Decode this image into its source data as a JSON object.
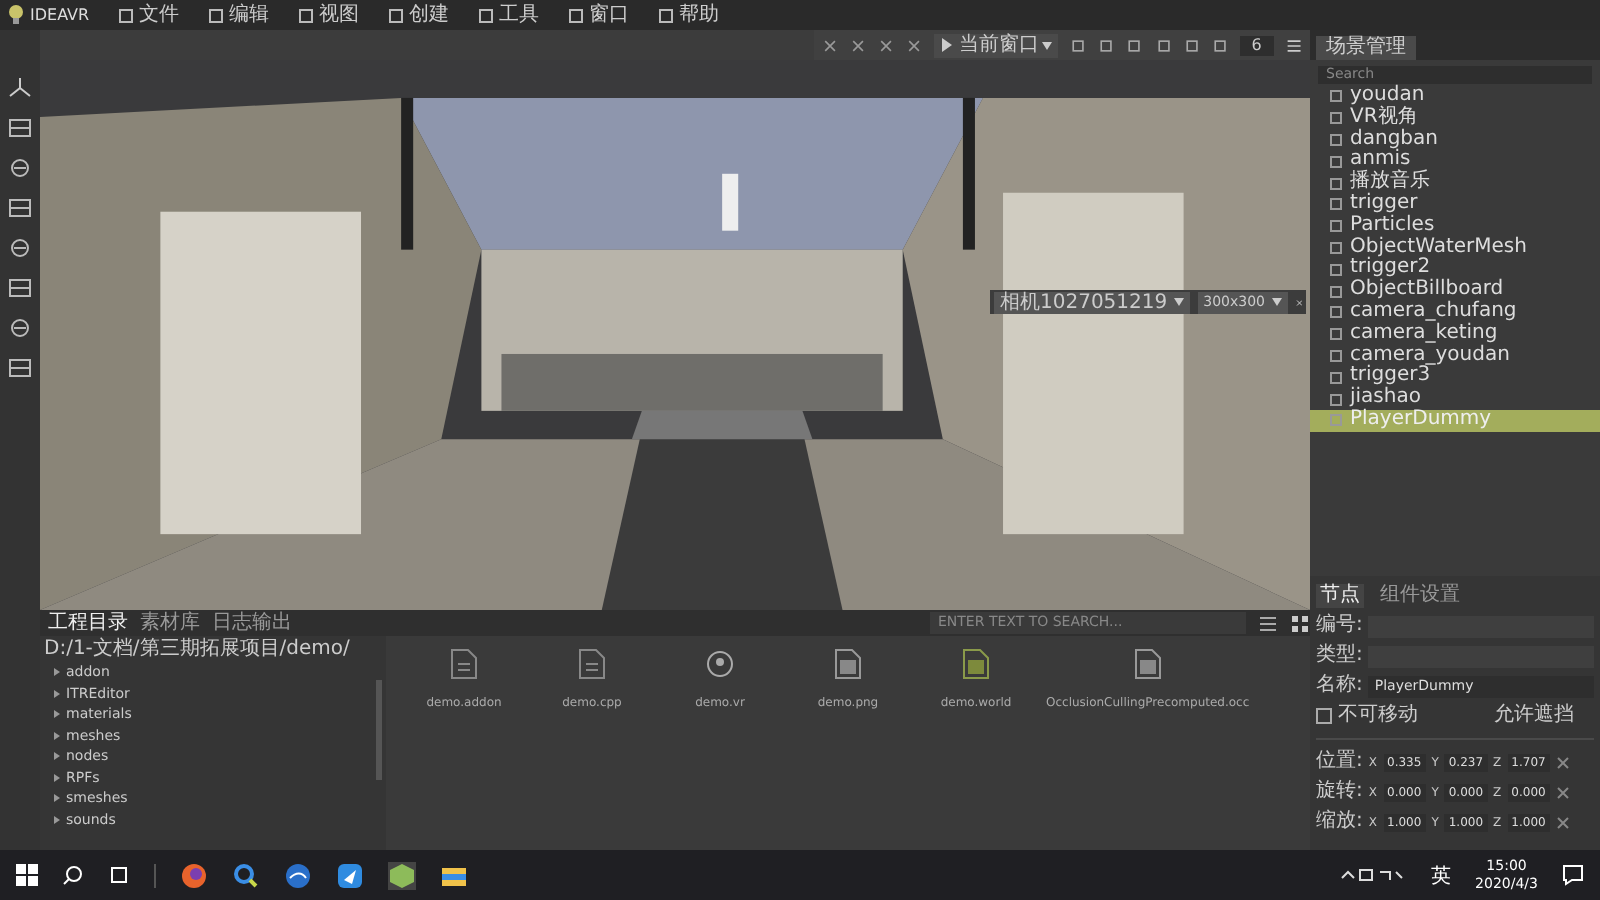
{
  "app": {
    "name": "IDEAVR"
  },
  "menus": [
    "文件",
    "编辑",
    "视图",
    "创建",
    "工具",
    "窗口",
    "帮助"
  ],
  "viewport_toolbar": {
    "view_select": "当前窗口",
    "spin_value": "6"
  },
  "viewport_overlay": {
    "camera_select": "相机1027051219",
    "size_select": "300x300"
  },
  "scene_panel": {
    "tab": "场景管理",
    "search_placeholder": "Search",
    "items": [
      {
        "label": "youdan",
        "selected": false
      },
      {
        "label": "VR视角",
        "selected": false
      },
      {
        "label": "dangban",
        "selected": false
      },
      {
        "label": "anmis",
        "selected": false
      },
      {
        "label": "播放音乐",
        "selected": false
      },
      {
        "label": "trigger",
        "selected": false
      },
      {
        "label": "Particles",
        "selected": false
      },
      {
        "label": "ObjectWaterMesh",
        "selected": false
      },
      {
        "label": "trigger2",
        "selected": false
      },
      {
        "label": "ObjectBillboard",
        "selected": false
      },
      {
        "label": "camera_chufang",
        "selected": false
      },
      {
        "label": "camera_keting",
        "selected": false
      },
      {
        "label": "camera_youdan",
        "selected": false
      },
      {
        "label": "trigger3",
        "selected": false
      },
      {
        "label": "jiashao",
        "selected": false
      },
      {
        "label": "PlayerDummy",
        "selected": true
      }
    ]
  },
  "properties": {
    "tabs": [
      {
        "label": "节点",
        "selected": true
      },
      {
        "label": "组件设置",
        "selected": false
      }
    ],
    "fields": [
      {
        "label": "编号:",
        "disabled": true
      },
      {
        "label": "类型:",
        "disabled": true
      },
      {
        "label": "名称:",
        "value": "PlayerDummy",
        "disabled": false
      }
    ],
    "lock": {
      "label": "不可移动",
      "checked": false
    },
    "extra_label": "允许遮挡",
    "transform": [
      {
        "label": "位置:",
        "values": [
          {
            "axis": "X",
            "value": "0.335"
          },
          {
            "axis": "Y",
            "value": "0.237"
          },
          {
            "axis": "Z",
            "value": "1.707"
          }
        ]
      },
      {
        "label": "旋转:",
        "values": [
          {
            "axis": "X",
            "value": "0.000"
          },
          {
            "axis": "Y",
            "value": "0.000"
          },
          {
            "axis": "Z",
            "value": "0.000"
          }
        ]
      },
      {
        "label": "缩放:",
        "values": [
          {
            "axis": "X",
            "value": "1.000"
          },
          {
            "axis": "Y",
            "value": "1.000"
          },
          {
            "axis": "Z",
            "value": "1.000"
          }
        ]
      }
    ]
  },
  "bottom_panel": {
    "tabs": [
      {
        "label": "工程目录",
        "selected": true
      },
      {
        "label": "素材库",
        "selected": false
      },
      {
        "label": "日志输出",
        "selected": false
      }
    ],
    "search_placeholder": "ENTER TEXT TO SEARCH...",
    "path": "D:/1-文档/第三期拓展项目/demo/",
    "tree": [
      "addon",
      "ITREditor",
      "materials",
      "meshes",
      "nodes",
      "RPFs",
      "smeshes",
      "sounds"
    ],
    "files": [
      {
        "name": "demo.addon",
        "kind": "doc"
      },
      {
        "name": "demo.cpp",
        "kind": "doc"
      },
      {
        "name": "demo.vr",
        "kind": "vr"
      },
      {
        "name": "demo.png"
      },
      {
        "name": "demo.world",
        "kind": "world"
      },
      {
        "name": "OcclusionCullingPrecomputed.occ"
      }
    ]
  },
  "taskbar": {
    "ime": "英",
    "time": "15:00",
    "date": "2020/4/3"
  }
}
